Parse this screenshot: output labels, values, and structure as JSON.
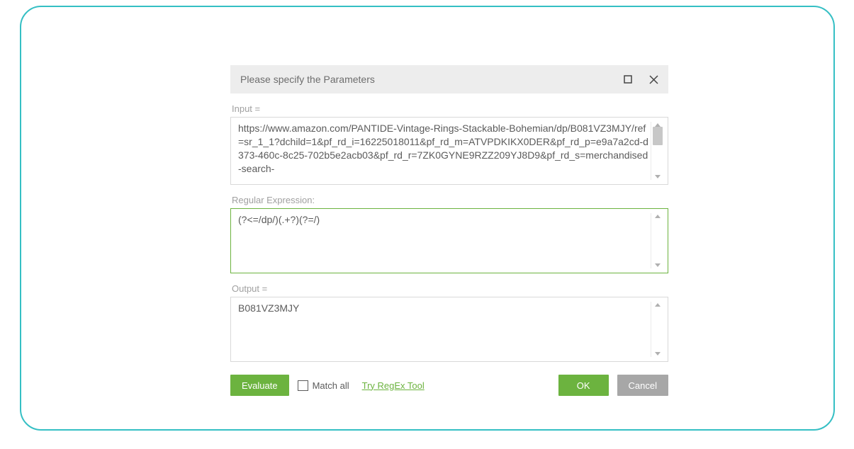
{
  "dialog": {
    "title": "Please specify the Parameters",
    "input_label": "Input =",
    "input_value": "https://www.amazon.com/PANTIDE-Vintage-Rings-Stackable-Bohemian/dp/B081VZ3MJY/ref=sr_1_1?dchild=1&pf_rd_i=16225018011&pf_rd_m=ATVPDKIKX0DER&pf_rd_p=e9a7a2cd-d373-460c-8c25-702b5e2acb03&pf_rd_r=7ZK0GYNE9RZZ209YJ8D9&pf_rd_s=merchandised-search-",
    "regex_label": "Regular Expression:",
    "regex_value": "(?<=/dp/)(.+?)(?=/)",
    "output_label": "Output =",
    "output_value": "B081VZ3MJY"
  },
  "footer": {
    "evaluate": "Evaluate",
    "match_all": "Match all",
    "try_tool": "Try RegEx Tool",
    "ok": "OK",
    "cancel": "Cancel"
  }
}
